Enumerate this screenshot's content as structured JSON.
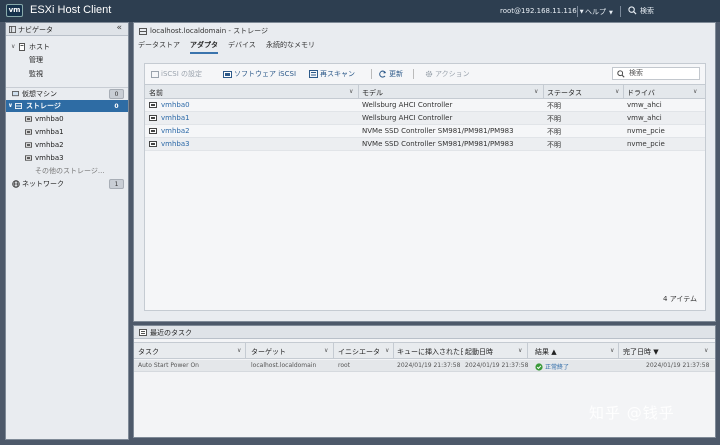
{
  "app": {
    "logo": "vm",
    "title": "ESXi Host Client"
  },
  "topbar": {
    "user": "root@192.168.11.116",
    "help": "ヘルプ",
    "search": "検索"
  },
  "navigator": {
    "title": "ナビゲータ",
    "items": [
      {
        "label": "ホスト"
      },
      {
        "label": "管理"
      },
      {
        "label": "監視"
      },
      {
        "label": "仮想マシン",
        "badge": "0"
      },
      {
        "label": "ストレージ",
        "badge": "0"
      },
      {
        "label": "vmhba0"
      },
      {
        "label": "vmhba1"
      },
      {
        "label": "vmhba2"
      },
      {
        "label": "vmhba3"
      },
      {
        "label": "その他のストレージ..."
      },
      {
        "label": "ネットワーク",
        "badge": "1"
      }
    ]
  },
  "breadcrumb": "localhost.localdomain - ストレージ",
  "tabs": [
    "データストア",
    "アダプタ",
    "デバイス",
    "永続的なメモリ"
  ],
  "toolbar": {
    "iscsi": "iSCSI の設定",
    "software_iscsi": "ソフトウェア iSCSI",
    "rescan": "再スキャン",
    "refresh": "更新",
    "actions": "アクション",
    "search_placeholder": "検索"
  },
  "adapters": {
    "columns": [
      "名前",
      "モデル",
      "ステータス",
      "ドライバ"
    ],
    "rows": [
      {
        "name": "vmhba0",
        "model": "Wellsburg AHCI Controller",
        "status": "不明",
        "driver": "vmw_ahci"
      },
      {
        "name": "vmhba1",
        "model": "Wellsburg AHCI Controller",
        "status": "不明",
        "driver": "vmw_ahci"
      },
      {
        "name": "vmhba2",
        "model": "NVMe SSD Controller SM981/PM981/PM983",
        "status": "不明",
        "driver": "nvme_pcie"
      },
      {
        "name": "vmhba3",
        "model": "NVMe SSD Controller SM981/PM981/PM983",
        "status": "不明",
        "driver": "nvme_pcie"
      }
    ],
    "count": "4 アイテム"
  },
  "tasks": {
    "title": "最近のタスク",
    "columns": [
      "タスク",
      "ターゲット",
      "イニシエータ",
      "キューに挿入された日",
      "起動日時",
      "結果 ▲",
      "完了日時 ▼"
    ],
    "rows": [
      {
        "task": "Auto Start Power On",
        "target": "localhost.localdomain",
        "initiator": "root",
        "queued": "2024/01/19 21:37:58",
        "started": "2024/01/19 21:37:58",
        "result": "正常終了",
        "completed": "2024/01/19 21:37:58"
      }
    ]
  },
  "watermark": "知乎 @钱乎"
}
